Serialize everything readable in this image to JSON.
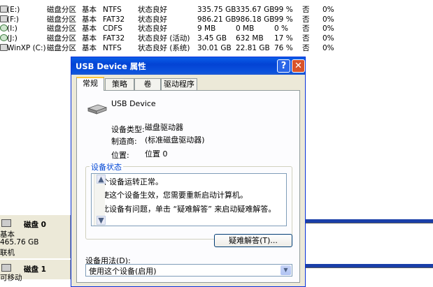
{
  "volumes": [
    {
      "icon": "disk-drive-icon",
      "drive": "(E:)",
      "layout": "磁盘分区",
      "type": "基本",
      "fs": "NTFS",
      "status": "状态良好",
      "capacity": "335.75 GB",
      "free": "335.67 GB",
      "percent": "99 %",
      "fault": "否",
      "overhead": "0%"
    },
    {
      "icon": "disk-drive-icon",
      "drive": "(F:)",
      "layout": "磁盘分区",
      "type": "基本",
      "fs": "FAT32",
      "status": "状态良好",
      "capacity": "986.21 GB",
      "free": "986.18 GB",
      "percent": "99 %",
      "fault": "否",
      "overhead": "0%"
    },
    {
      "icon": "cd-drive-icon",
      "drive": "(I:)",
      "layout": "磁盘分区",
      "type": "基本",
      "fs": "CDFS",
      "status": "状态良好",
      "capacity": "9 MB",
      "free": "0 MB",
      "percent": "0 %",
      "fault": "否",
      "overhead": "0%"
    },
    {
      "icon": "cd-drive-icon",
      "drive": "(J:)",
      "layout": "磁盘分区",
      "type": "基本",
      "fs": "FAT32",
      "status": "状态良好 (活动)",
      "capacity": "3.45 GB",
      "free": "632 MB",
      "percent": "17 %",
      "fault": "否",
      "overhead": "0%"
    },
    {
      "icon": "disk-drive-icon",
      "drive": "WinXP (C:)",
      "layout": "磁盘分区",
      "type": "基本",
      "fs": "NTFS",
      "status": "状态良好 (系统)",
      "capacity": "30.01 GB",
      "free": "22.81 GB",
      "percent": "76 %",
      "fault": "否",
      "overhead": "0%"
    }
  ],
  "disk_map": {
    "disk0": {
      "name": "磁盘 0",
      "type": "基本",
      "size": "465.76 GB",
      "state": "联机"
    },
    "disk1": {
      "name": "磁盘 1",
      "type": "可移动"
    }
  },
  "dialog": {
    "title": "USB Device 属性",
    "help_glyph": "?",
    "close_glyph": "✕",
    "tabs": [
      "常规",
      "策略",
      "卷",
      "驱动程序"
    ],
    "device_name": "USB Device",
    "device_type_label": "设备类型:",
    "device_type_value": "磁盘驱动器",
    "manufacturer_label": "制造商:",
    "manufacturer_value": "(标准磁盘驱动器)",
    "location_label": "位置:",
    "location_value": "位置 0",
    "status_group_label": "设备状态",
    "status_lines": [
      "这个设备运转正常。",
      "要使这个设备生效，您需要重新启动计算机。",
      "若此设备有问题，单击 “疑难解答” 来启动疑难解答。"
    ],
    "troubleshoot_button": "疑难解答(T)...",
    "usage_label": "设备用法(D):",
    "usage_value": "使用这个设备(启用)"
  }
}
